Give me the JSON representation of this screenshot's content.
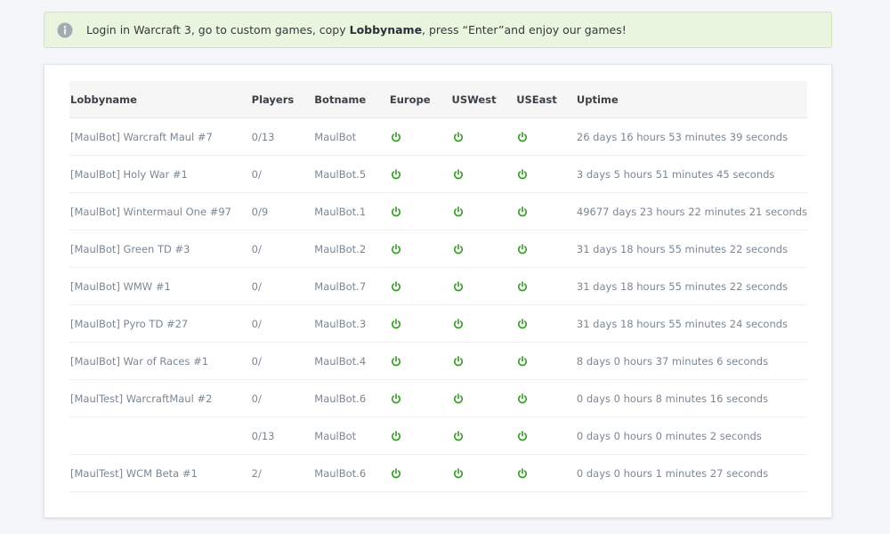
{
  "alert": {
    "text_before": "Login in Warcraft 3, go to custom games, copy ",
    "text_bold": "Lobbyname",
    "text_after": ", press “Enter”and enjoy our games!",
    "icon": "info-icon"
  },
  "table": {
    "headers": [
      "Lobbyname",
      "Players",
      "Botname",
      "Europe",
      "USWest",
      "USEast",
      "Uptime"
    ],
    "status_icon": "power-icon",
    "status_color": "#3aa02a",
    "rows": [
      {
        "lobby": "[MaulBot] Warcraft Maul #7",
        "players": "0/13",
        "bot": "MaulBot",
        "uptime": "26 days 16 hours 53 minutes 39 seconds"
      },
      {
        "lobby": "[MaulBot] Holy War #1",
        "players": "0/",
        "bot": "MaulBot.5",
        "uptime": "3 days 5 hours 51 minutes 45 seconds"
      },
      {
        "lobby": "[MaulBot] Wintermaul One #97",
        "players": "0/9",
        "bot": "MaulBot.1",
        "uptime": "49677 days 23 hours 22 minutes 21 seconds"
      },
      {
        "lobby": "[MaulBot] Green TD #3",
        "players": "0/",
        "bot": "MaulBot.2",
        "uptime": "31 days 18 hours 55 minutes 22 seconds"
      },
      {
        "lobby": "[MaulBot] WMW #1",
        "players": "0/",
        "bot": "MaulBot.7",
        "uptime": "31 days 18 hours 55 minutes 22 seconds"
      },
      {
        "lobby": "[MaulBot] Pyro TD #27",
        "players": "0/",
        "bot": "MaulBot.3",
        "uptime": "31 days 18 hours 55 minutes 24 seconds"
      },
      {
        "lobby": "[MaulBot] War of Races #1",
        "players": "0/",
        "bot": "MaulBot.4",
        "uptime": "8 days 0 hours 37 minutes 6 seconds"
      },
      {
        "lobby": "[MaulTest] WarcraftMaul #2",
        "players": "0/",
        "bot": "MaulBot.6",
        "uptime": "0 days 0 hours 8 minutes 16 seconds"
      },
      {
        "lobby": "",
        "players": "0/13",
        "bot": "MaulBot",
        "uptime": "0 days 0 hours 0 minutes 2 seconds"
      },
      {
        "lobby": "[MaulTest] WCM Beta #1",
        "players": "2/",
        "bot": "MaulBot.6",
        "uptime": "0 days 0 hours 1 minutes 27 seconds"
      }
    ]
  }
}
